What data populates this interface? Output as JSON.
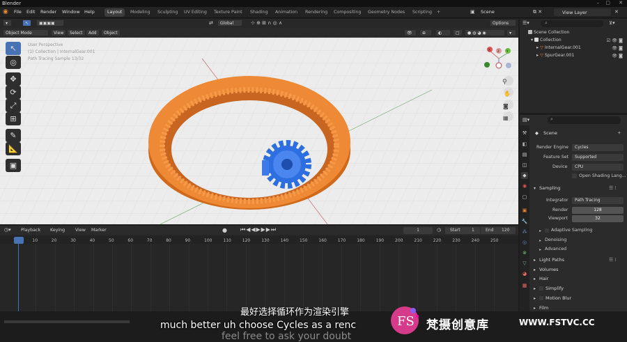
{
  "app": {
    "title": "Blender"
  },
  "menus": [
    "File",
    "Edit",
    "Render",
    "Window",
    "Help"
  ],
  "workspaces": [
    "Layout",
    "Modeling",
    "Sculpting",
    "UV Editing",
    "Texture Paint",
    "Shading",
    "Animation",
    "Rendering",
    "Compositing",
    "Geometry Nodes",
    "Scripting"
  ],
  "active_workspace": "Layout",
  "add_workspace": "+",
  "scene": {
    "label": "Scene"
  },
  "view_layer": {
    "label": "View Layer"
  },
  "viewport": {
    "transform": "Global",
    "mode": "Object Mode",
    "menu": [
      "View",
      "Select",
      "Add",
      "Object"
    ],
    "options": "Options",
    "overlay_lines": [
      "User Perspective",
      "(1) Collection | InternalGear.001",
      "Path Tracing Sample 13/32"
    ],
    "gizmo_axes": {
      "x": "X",
      "y": "Y",
      "z": "Z"
    }
  },
  "outliner": {
    "items": [
      {
        "name": "Scene Collection"
      },
      {
        "name": "Collection"
      },
      {
        "name": "InternalGear.001"
      },
      {
        "name": "SpurGear.001"
      }
    ]
  },
  "properties": {
    "context": "Scene",
    "render_engine": {
      "label": "Render Engine",
      "value": "Cycles"
    },
    "feature_set": {
      "label": "Feature Set",
      "value": "Supported"
    },
    "device": {
      "label": "Device",
      "value": "CPU"
    },
    "open_shading": "Open Shading Lang...",
    "sampling": {
      "title": "Sampling",
      "integrator": {
        "label": "Integrator",
        "value": "Path Tracing"
      },
      "render": {
        "label": "Render",
        "value": "128"
      },
      "viewport": {
        "label": "Viewport",
        "value": "32"
      },
      "sub": [
        "Adaptive Sampling",
        "Denoising",
        "Advanced"
      ]
    },
    "panels": [
      "Light Paths",
      "Volumes",
      "Hair",
      "Simplify",
      "Motion Blur",
      "Film"
    ]
  },
  "timeline": {
    "menu": [
      "Playback",
      "Keying",
      "View",
      "Marker"
    ],
    "current_frame": "1",
    "start_label": "Start",
    "start": "1",
    "end_label": "End",
    "end": "120",
    "ruler": [
      "1",
      "10",
      "20",
      "30",
      "40",
      "50",
      "60",
      "70",
      "80",
      "90",
      "100",
      "110",
      "120",
      "130",
      "140",
      "150",
      "160",
      "170",
      "180",
      "190",
      "200",
      "210",
      "220",
      "230",
      "240",
      "250"
    ]
  },
  "subtitles": {
    "cn": "最好选择循环作为渲染引擎",
    "en": "much better uh choose Cycles as a renc",
    "en_next": "feel free to ask your doubt"
  },
  "watermark": {
    "logo_text": "FS",
    "brand": "梵摄创意库",
    "url": "WWW.FSTVC.CC"
  },
  "colors": {
    "accent": "#4772b3",
    "ring": "#e8822f",
    "gear": "#2d6fe0",
    "viewport_bg": "#ececec"
  }
}
